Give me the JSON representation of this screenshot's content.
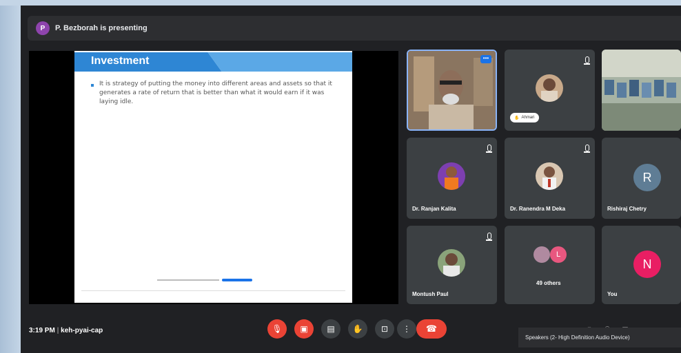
{
  "presenting_bar": {
    "avatar_letter": "P",
    "text": "P. Bezborah is presenting"
  },
  "slide": {
    "title": "Investment",
    "body": "It is strategy of putting the money into different areas and assets so that it generates a rate of return that is better than what it would earn if it was laying idle."
  },
  "participants": [
    {
      "name": "Ahmari"
    },
    {
      "name": "Dr. Ranjan Kalita"
    },
    {
      "name": "Dr. Ranendra M Deka"
    },
    {
      "name": "Rishiraj Chetry",
      "avatar_letter": "R"
    },
    {
      "name": "Montush Paul"
    },
    {
      "name": "49 others",
      "avatar_letter": "L"
    },
    {
      "name": "You",
      "avatar_letter": "N"
    }
  ],
  "bottom_bar": {
    "time": "3:19 PM",
    "meeting_code": "keh-pyai-cap"
  },
  "tooltip": {
    "text": "Speakers (2- High Definition Audio Device)"
  },
  "colors": {
    "background": "#202124",
    "tile": "#3c4043",
    "accent": "#1a73e8",
    "danger": "#ea4335"
  }
}
